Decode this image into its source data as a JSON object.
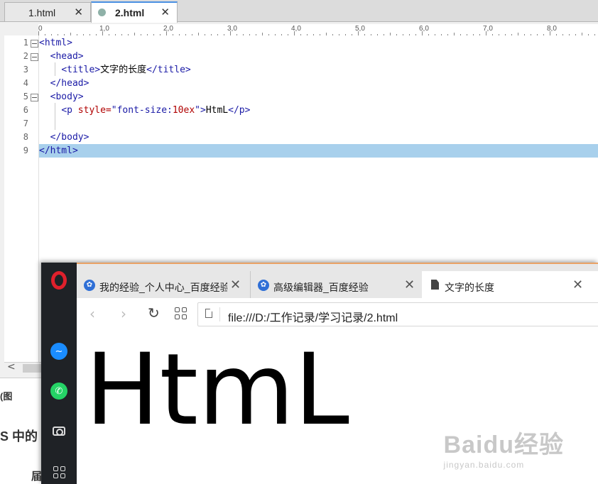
{
  "background_page": {
    "line1": "(图",
    "line2": "S 中的",
    "line3": "届"
  },
  "editor": {
    "tabs": [
      {
        "label": "1.html",
        "close": "✕"
      },
      {
        "label": "2.html",
        "close": "✕"
      }
    ],
    "ruler_labels": [
      "0",
      "1,0",
      "2,0",
      "3,0",
      "4,0",
      "5,0",
      "6,0",
      "7,0",
      "8,0"
    ],
    "line_numbers": [
      "1",
      "2",
      "3",
      "4",
      "5",
      "6",
      "7",
      "8",
      "9"
    ],
    "code": {
      "l1": "<html>",
      "l2": "<head>",
      "l3_open": "<title>",
      "l3_text": "文字的长度",
      "l3_close": "</title>",
      "l4": "</head>",
      "l5": "<body>",
      "l6_open": "<p ",
      "l6_attr": "style=",
      "l6_q1": "\"font-size:",
      "l6_val": "10ex",
      "l6_q2": "\"",
      "l6_gt": ">",
      "l6_text": "HtmL",
      "l6_close": "</p>",
      "l8": "</body>",
      "l9": "</html>"
    },
    "scroll_arrow": "<"
  },
  "browser": {
    "tabs": [
      {
        "label": "我的经验_个人中心_百度经验",
        "icon": "paw-icon",
        "close": "✕"
      },
      {
        "label": "高级编辑器_百度经验",
        "icon": "paw-icon",
        "close": "✕"
      },
      {
        "label": "文字的长度",
        "icon": "document-icon",
        "close": "✕"
      }
    ],
    "nav": {
      "back": "‹",
      "forward": "›",
      "reload": "↻"
    },
    "url": "file:///D:/工作记录/学习记录/2.html",
    "page_text": "HtmL",
    "sidebar_icons": [
      "opera-logo-icon",
      "messenger-icon",
      "whatsapp-icon",
      "camera-icon",
      "apps-grid-icon"
    ]
  },
  "watermark": {
    "brand": "Baidu经验",
    "domain": "jingyan.baidu.com"
  },
  "colors": {
    "tag": "#1a1aa6",
    "attr": "#b00000",
    "highlight": "#a8d0ec",
    "opera_red": "#e0202c",
    "sidebar_bg": "#1f2226"
  }
}
